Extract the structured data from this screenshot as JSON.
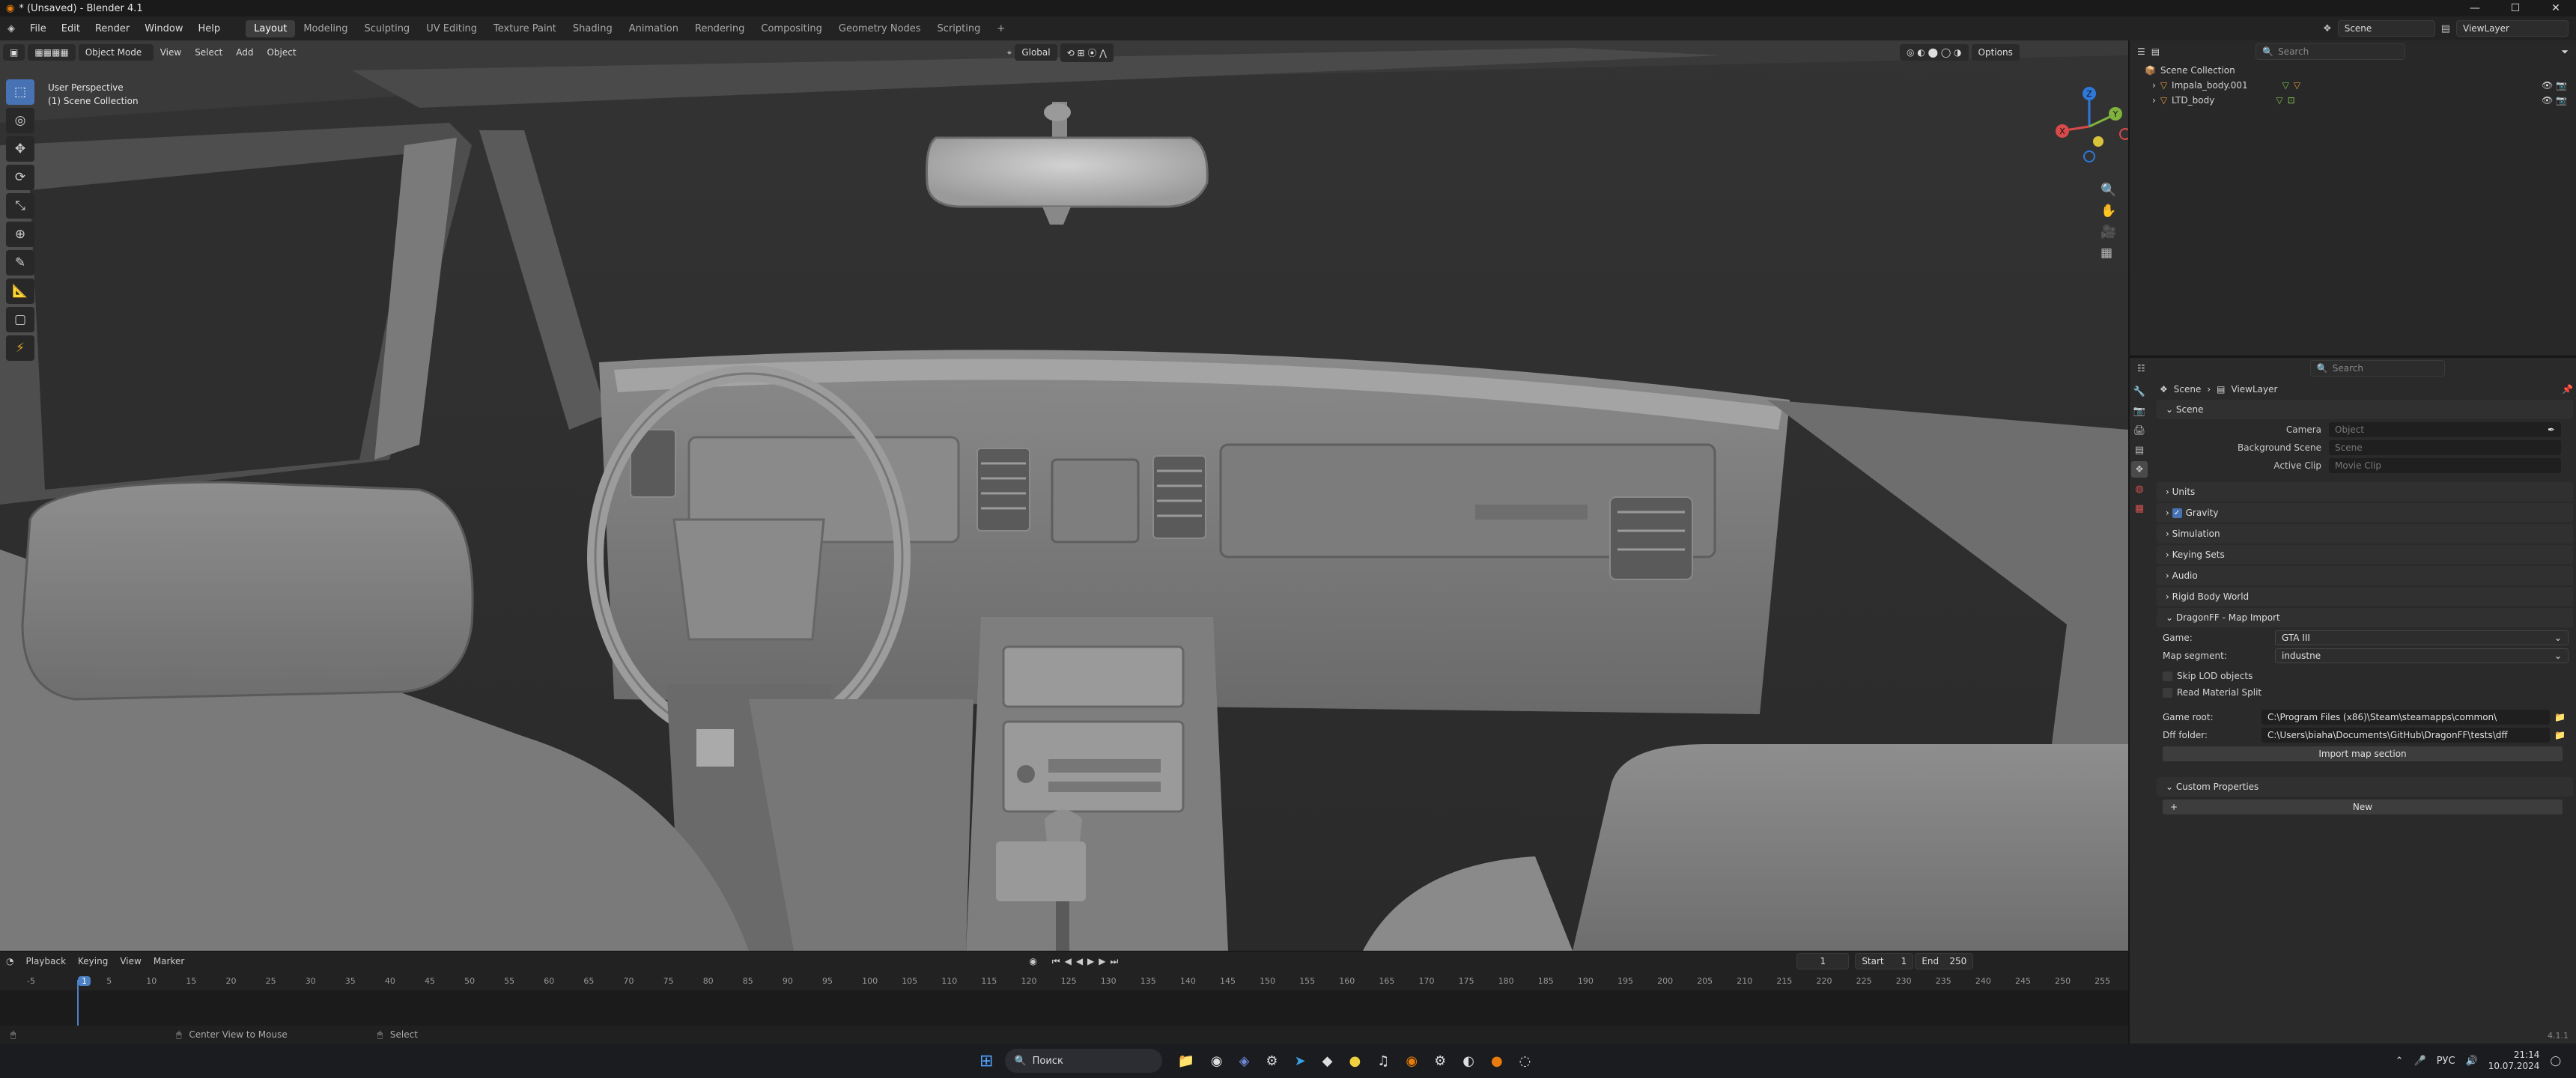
{
  "window": {
    "title": "* (Unsaved) - Blender 4.1",
    "minimize": "—",
    "maximize": "☐",
    "close": "✕"
  },
  "menus": [
    "File",
    "Edit",
    "Render",
    "Window",
    "Help"
  ],
  "workspaces": [
    "Layout",
    "Modeling",
    "Sculpting",
    "UV Editing",
    "Texture Paint",
    "Shading",
    "Animation",
    "Rendering",
    "Compositing",
    "Geometry Nodes",
    "Scripting"
  ],
  "workspace_add": "+",
  "scene_name": "Scene",
  "view_layer": "ViewLayer",
  "viewport": {
    "mode": "Object Mode",
    "menus": [
      "View",
      "Select",
      "Add",
      "Object"
    ],
    "transform": "Global",
    "options": "Options",
    "perspective": "User Perspective",
    "collection": "(1) Scene Collection",
    "gizmo": {
      "x": "X",
      "y": "Y",
      "z": "Z"
    }
  },
  "outliner": {
    "search_placeholder": "Search",
    "root": "Scene Collection",
    "items": [
      "Impala_body.001",
      "LTD_body"
    ]
  },
  "properties": {
    "search_placeholder": "Search",
    "breadcrumb": [
      "Scene",
      "ViewLayer"
    ],
    "scene_panel": "Scene",
    "camera_label": "Camera",
    "camera_placeholder": "Object",
    "bg_label": "Background Scene",
    "bg_placeholder": "Scene",
    "clip_label": "Active Clip",
    "clip_placeholder": "Movie Clip",
    "panels": [
      "Units",
      "Gravity",
      "Simulation",
      "Keying Sets",
      "Audio",
      "Rigid Body World"
    ],
    "dragon_panel": "DragonFF - Map Import",
    "game_label": "Game:",
    "game_value": "GTA III",
    "segment_label": "Map segment:",
    "segment_value": "industne",
    "skip_lod": "Skip LOD objects",
    "read_mat": "Read Material Split",
    "root_label": "Game root:",
    "root_value": "C:\\Program Files (x86)\\Steam\\steamapps\\common\\",
    "dff_label": "Dff folder:",
    "dff_value": "C:\\Users\\biaha\\Documents\\GitHub\\DragonFF\\tests\\dff",
    "import_btn": "Import map section",
    "custom_panel": "Custom Properties",
    "new_btn": "New"
  },
  "timeline": {
    "menus": [
      "Playback",
      "Keying",
      "View",
      "Marker"
    ],
    "current_frame": "1",
    "start_label": "Start",
    "start": "1",
    "end_label": "End",
    "end": "250",
    "ticks": [
      "-5",
      "1",
      "5",
      "10",
      "15",
      "20",
      "25",
      "30",
      "35",
      "40",
      "45",
      "50",
      "55",
      "60",
      "65",
      "70",
      "75",
      "80",
      "85",
      "90",
      "95",
      "100",
      "105",
      "110",
      "115",
      "120",
      "125",
      "130",
      "135",
      "140",
      "145",
      "150",
      "155",
      "160",
      "165",
      "170",
      "175",
      "180",
      "185",
      "190",
      "195",
      "200",
      "205",
      "210",
      "215",
      "220",
      "225",
      "230",
      "235",
      "240",
      "245",
      "250",
      "255"
    ]
  },
  "status": {
    "hint1": "Center View to Mouse",
    "hint2": "Select",
    "version": "4.1.1"
  },
  "taskbar": {
    "search": "Поиск",
    "lang": "РУС",
    "time": "21:14",
    "date": "10.07.2024"
  }
}
